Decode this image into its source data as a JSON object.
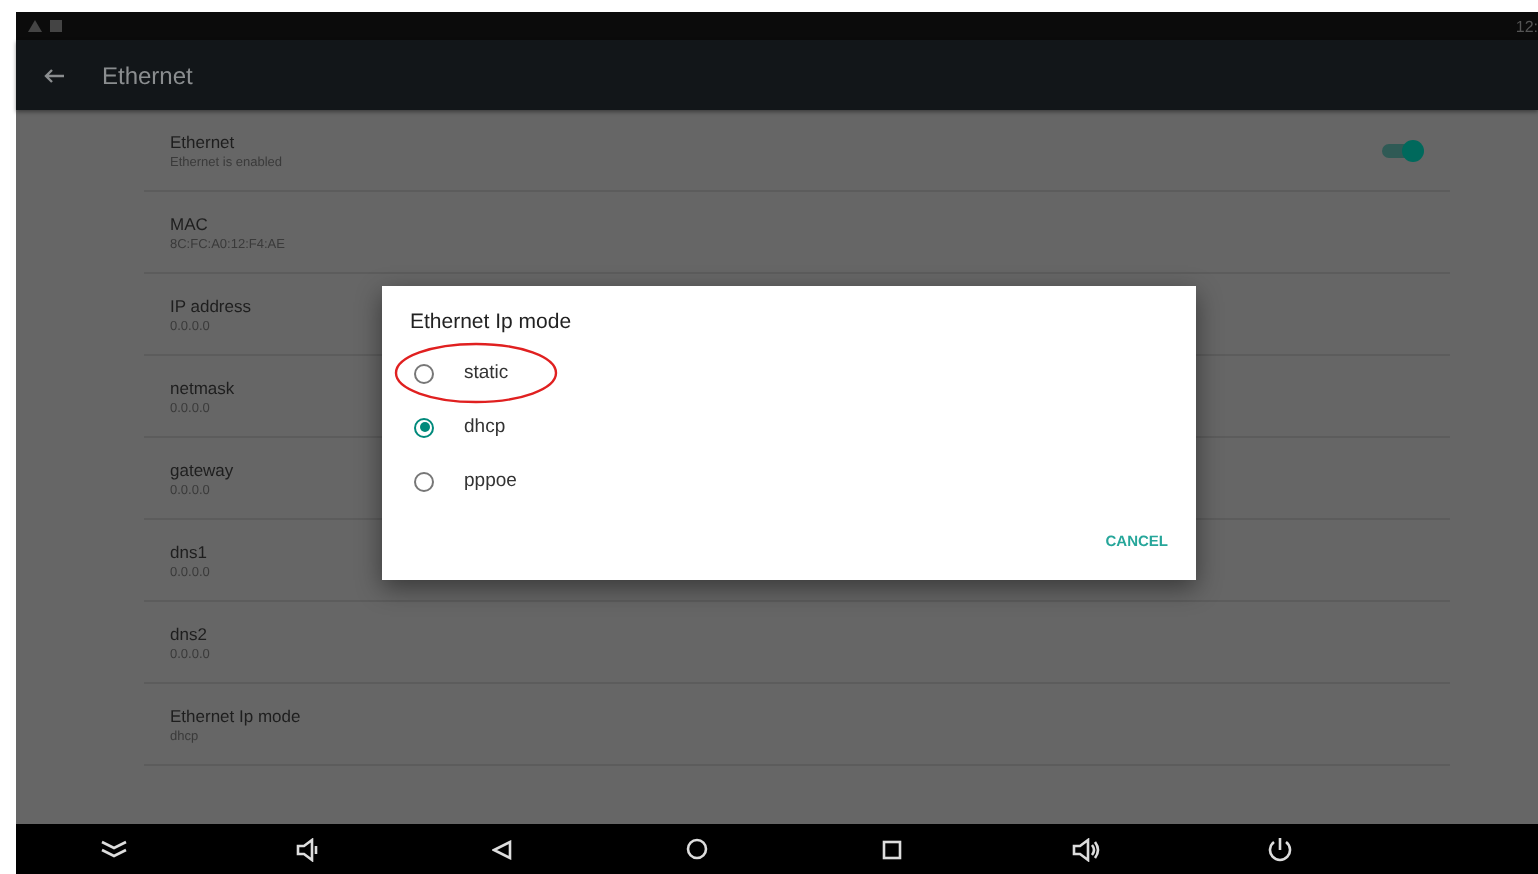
{
  "status_bar": {
    "time": "12:"
  },
  "toolbar": {
    "title": "Ethernet"
  },
  "settings": [
    {
      "kind": "switch",
      "title": "Ethernet",
      "summary": "Ethernet is enabled",
      "on": true
    },
    {
      "kind": "text",
      "title": "MAC",
      "summary": "8C:FC:A0:12:F4:AE"
    },
    {
      "kind": "text",
      "title": "IP address",
      "summary": "0.0.0.0"
    },
    {
      "kind": "text",
      "title": "netmask",
      "summary": "0.0.0.0"
    },
    {
      "kind": "text",
      "title": "gateway",
      "summary": "0.0.0.0"
    },
    {
      "kind": "text",
      "title": "dns1",
      "summary": "0.0.0.0"
    },
    {
      "kind": "text",
      "title": "dns2",
      "summary": "0.0.0.0"
    },
    {
      "kind": "text",
      "title": "Ethernet Ip mode",
      "summary": "dhcp"
    }
  ],
  "dialog": {
    "title": "Ethernet Ip mode",
    "options": [
      {
        "label": "static",
        "selected": false,
        "circled": true
      },
      {
        "label": "dhcp",
        "selected": true,
        "circled": false
      },
      {
        "label": "pppoe",
        "selected": false,
        "circled": false
      }
    ],
    "buttons": [
      "CANCEL"
    ]
  }
}
